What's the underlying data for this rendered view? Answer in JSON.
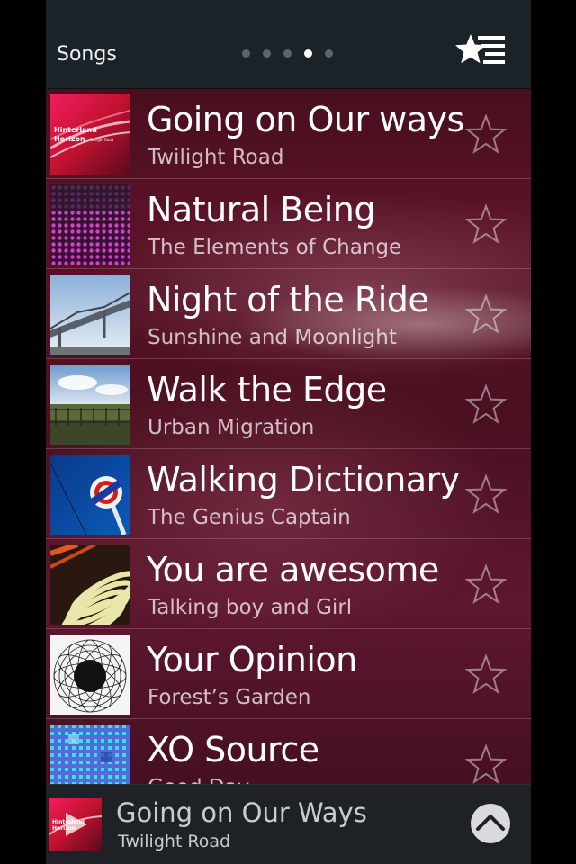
{
  "header": {
    "title": "Songs",
    "page_count": 5,
    "active_page": 4,
    "favorites_icon": "star-list-icon"
  },
  "songs": [
    {
      "title": "Going on Our ways",
      "artist": "Twilight Road",
      "art": "hinterland-horizon-art",
      "art_lines": [
        "Hinterland",
        "Horizon",
        "Twilight Road"
      ],
      "favorite": false
    },
    {
      "title": "Natural Being",
      "artist": "The Elements of Change",
      "art": "magenta-dots-art",
      "favorite": false
    },
    {
      "title": "Night of the Ride",
      "artist": "Sunshine and Moonlight",
      "art": "bridge-photo-art",
      "favorite": false
    },
    {
      "title": "Walk the Edge",
      "artist": "Urban Migration",
      "art": "fence-landscape-art",
      "favorite": false
    },
    {
      "title": "Walking Dictionary",
      "artist": "The Genius Captain",
      "art": "blue-sign-art",
      "favorite": false
    },
    {
      "title": "You are awesome",
      "artist": "Talking boy and Girl",
      "art": "yellow-coil-art",
      "favorite": false
    },
    {
      "title": "Your Opinion",
      "artist": "Forest’s Garden",
      "art": "spiral-pattern-art",
      "favorite": false
    },
    {
      "title": "XO Source",
      "artist": "Good Day",
      "art": "blue-mosaic-art",
      "favorite": false
    }
  ],
  "now_playing": {
    "title": "Going on Our Ways",
    "artist": "Twilight Road",
    "art_lines": [
      "Hinterland",
      "Horizon"
    ],
    "play_icon": "play-icon",
    "expand_icon": "chevron-up-icon"
  },
  "colors": {
    "header_bg": "#1c2328",
    "player_bg": "#1e2226",
    "background_accent": "#5a1326",
    "text_primary": "#ffffff"
  }
}
